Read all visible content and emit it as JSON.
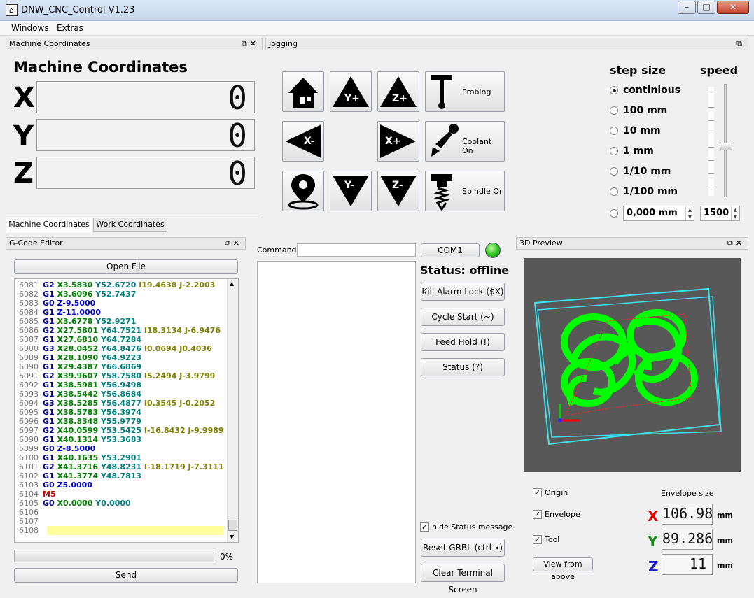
{
  "window": {
    "title": "DNW_CNC_Control V1.23",
    "minimize": "–",
    "maximize": "□",
    "close": "✕"
  },
  "menu": [
    "Windows",
    "Extras"
  ],
  "docks": {
    "machine": {
      "header": "Machine Coordinates",
      "title": "Machine Coordinates"
    },
    "jogging": {
      "header": "Jogging"
    },
    "gcode": {
      "header": "G-Code Editor"
    },
    "preview": {
      "header": "3D Preview"
    }
  },
  "coords": [
    {
      "axis": "X",
      "value": "0"
    },
    {
      "axis": "Y",
      "value": "0"
    },
    {
      "axis": "Z",
      "value": "0"
    }
  ],
  "tabs": [
    "Machine Coordinates",
    "Work Coordinates"
  ],
  "jog": {
    "yplus": "Y+",
    "zplus": "Z+",
    "xminus": "X-",
    "xplus": "X+",
    "yminus": "Y-",
    "zminus": "Z-",
    "probing": "Probing",
    "coolant": "Coolant On",
    "spindle": "Spindle On"
  },
  "step": {
    "title": "step size",
    "speed_title": "speed",
    "options": [
      "continious",
      "100 mm",
      "10 mm",
      "1 mm",
      "1/10 mm",
      "1/100 mm"
    ],
    "custom_value": "0,000 mm",
    "speed_value": "1500",
    "speed_slider_level": 0.45
  },
  "gcode": {
    "open_file": "Open File",
    "progress_text": "0%",
    "progress": 0,
    "send": "Send",
    "lines": [
      {
        "n": "6081",
        "t": [
          [
            "G2",
            "g"
          ],
          [
            " X3.5830",
            "x"
          ],
          [
            " Y52.6720",
            "y"
          ],
          [
            " I19.4638 J-2.2003",
            "ij"
          ]
        ]
      },
      {
        "n": "6082",
        "t": [
          [
            "G1",
            "g"
          ],
          [
            " X3.6096",
            "x"
          ],
          [
            " Y52.7437",
            "y"
          ]
        ]
      },
      {
        "n": "6083",
        "t": [
          [
            "G0",
            "g"
          ],
          [
            " Z-9.5000",
            "z"
          ]
        ]
      },
      {
        "n": "6084",
        "t": [
          [
            "G1",
            "g"
          ],
          [
            " Z-11.0000",
            "z"
          ]
        ]
      },
      {
        "n": "6085",
        "t": [
          [
            "G1",
            "g"
          ],
          [
            " X3.6778",
            "x"
          ],
          [
            " Y52.9271",
            "y"
          ]
        ]
      },
      {
        "n": "6086",
        "t": [
          [
            "G2",
            "g"
          ],
          [
            " X27.5801",
            "x"
          ],
          [
            " Y64.7521",
            "y"
          ],
          [
            " I18.3134 J-6.9476",
            "ij"
          ]
        ]
      },
      {
        "n": "6087",
        "t": [
          [
            "G1",
            "g"
          ],
          [
            " X27.6810",
            "x"
          ],
          [
            " Y64.7284",
            "y"
          ]
        ]
      },
      {
        "n": "6088",
        "t": [
          [
            "G3",
            "g"
          ],
          [
            " X28.0452",
            "x"
          ],
          [
            " Y64.8476",
            "y"
          ],
          [
            " I0.0694 J0.4036",
            "ij"
          ]
        ]
      },
      {
        "n": "6089",
        "t": [
          [
            "G1",
            "g"
          ],
          [
            " X28.1090",
            "x"
          ],
          [
            " Y64.9223",
            "y"
          ]
        ]
      },
      {
        "n": "6090",
        "t": [
          [
            "G1",
            "g"
          ],
          [
            " X29.4387",
            "x"
          ],
          [
            " Y66.6869",
            "y"
          ]
        ]
      },
      {
        "n": "6091",
        "t": [
          [
            "G2",
            "g"
          ],
          [
            " X39.9607",
            "x"
          ],
          [
            " Y58.7580",
            "y"
          ],
          [
            " I5.2494 J-3.9799",
            "ij"
          ]
        ]
      },
      {
        "n": "6092",
        "t": [
          [
            "G1",
            "g"
          ],
          [
            " X38.5981",
            "x"
          ],
          [
            " Y56.9498",
            "y"
          ]
        ]
      },
      {
        "n": "6093",
        "t": [
          [
            "G1",
            "g"
          ],
          [
            " X38.5442",
            "x"
          ],
          [
            " Y56.8684",
            "y"
          ]
        ]
      },
      {
        "n": "6094",
        "t": [
          [
            "G3",
            "g"
          ],
          [
            " X38.5285",
            "x"
          ],
          [
            " Y56.4877",
            "y"
          ],
          [
            " I0.3545 J-0.2052",
            "ij"
          ]
        ]
      },
      {
        "n": "6095",
        "t": [
          [
            "G1",
            "g"
          ],
          [
            " X38.5783",
            "x"
          ],
          [
            " Y56.3974",
            "y"
          ]
        ]
      },
      {
        "n": "6096",
        "t": [
          [
            "G1",
            "g"
          ],
          [
            " X38.8348",
            "x"
          ],
          [
            " Y55.9779",
            "y"
          ]
        ]
      },
      {
        "n": "6097",
        "t": [
          [
            "G2",
            "g"
          ],
          [
            " X40.0599",
            "x"
          ],
          [
            " Y53.5425",
            "y"
          ],
          [
            " I-16.8432 J-9.9989",
            "ij"
          ]
        ]
      },
      {
        "n": "6098",
        "t": [
          [
            "G1",
            "g"
          ],
          [
            " X40.1314",
            "x"
          ],
          [
            " Y53.3683",
            "y"
          ]
        ]
      },
      {
        "n": "6099",
        "t": [
          [
            "G0",
            "g"
          ],
          [
            " Z-8.5000",
            "z"
          ]
        ]
      },
      {
        "n": "6100",
        "t": [
          [
            "G1",
            "g"
          ],
          [
            " X40.1635",
            "x"
          ],
          [
            " Y53.2901",
            "y"
          ]
        ]
      },
      {
        "n": "6101",
        "t": [
          [
            "G2",
            "g"
          ],
          [
            " X41.3716",
            "x"
          ],
          [
            " Y48.8231",
            "y"
          ],
          [
            " I-18.1719 J-7.3111",
            "ij"
          ]
        ]
      },
      {
        "n": "6102",
        "t": [
          [
            "G1",
            "g"
          ],
          [
            " X41.3774",
            "x"
          ],
          [
            " Y48.7813",
            "y"
          ]
        ]
      },
      {
        "n": "6103",
        "t": [
          [
            "G0",
            "g"
          ],
          [
            " Z5.0000",
            "z"
          ]
        ]
      },
      {
        "n": "6104",
        "t": [
          [
            "M5",
            "m"
          ]
        ]
      },
      {
        "n": "6105",
        "t": [
          [
            "G0",
            "g"
          ],
          [
            " X0.0000",
            "x"
          ],
          [
            " Y0.0000",
            "y"
          ]
        ]
      },
      {
        "n": "6106",
        "t": []
      },
      {
        "n": "6107",
        "t": []
      },
      {
        "n": "6108",
        "t": []
      }
    ]
  },
  "terminal": {
    "command_label": "Command:",
    "command_value": "",
    "port": "COM1",
    "status": "Status: offline",
    "buttons": [
      "Kill Alarm Lock ($X)",
      "Cycle Start (~)",
      "Feed Hold (!)",
      "Status (?)"
    ],
    "hide_status": "hide Status message",
    "reset": "Reset GRBL (ctrl-x)",
    "clear": "Clear Terminal Screen"
  },
  "preview": {
    "origin": "Origin",
    "envelope": "Envelope",
    "tool": "Tool",
    "view_from_above": "View from above",
    "envelope_size": "Envelope size",
    "env": [
      {
        "axis": "X",
        "value": "106.98",
        "unit": "mm",
        "color": "#e00000"
      },
      {
        "axis": "Y",
        "value": "89.286",
        "unit": "mm",
        "color": "#1a8a1a"
      },
      {
        "axis": "Z",
        "value": "11",
        "unit": "mm",
        "color": "#1a1acc"
      }
    ]
  },
  "colors": {
    "accent_green": "#00ff00",
    "preview_bg": "#585858",
    "envelope_cyan": "#3fe0e8"
  }
}
